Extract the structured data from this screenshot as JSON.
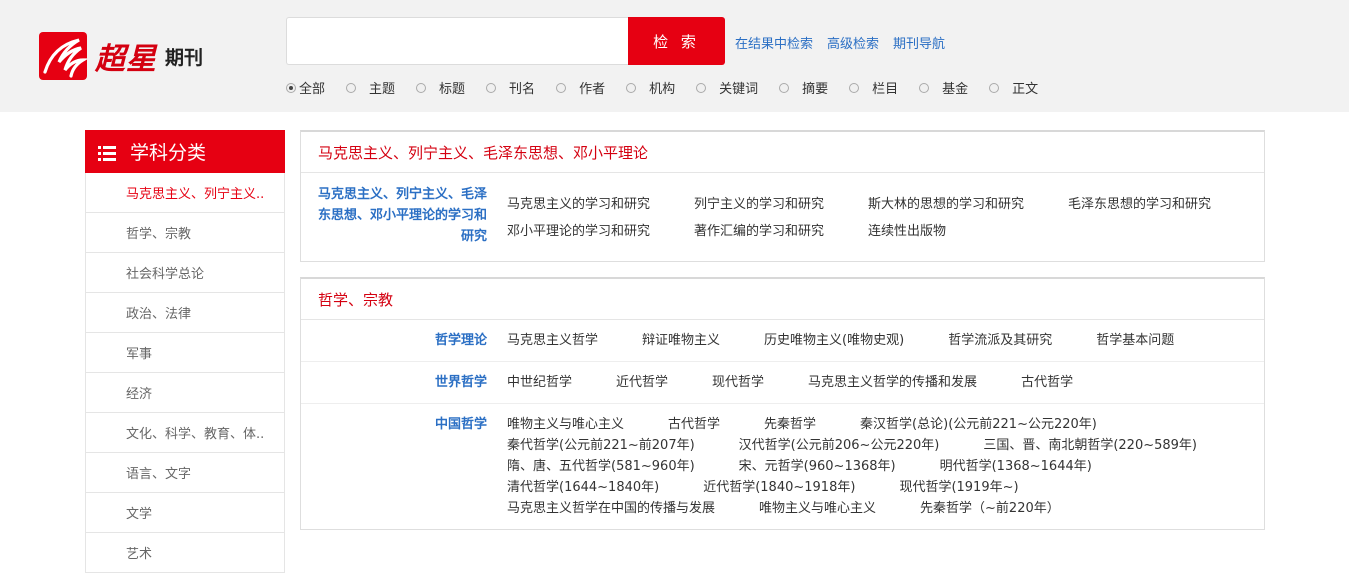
{
  "header": {
    "brand": "超星",
    "brand_sub": "期刊",
    "search_placeholder": "",
    "search_button": "检 索",
    "links": [
      "在结果中检索",
      "高级检索",
      "期刊导航"
    ],
    "scopes": [
      {
        "label": "全部",
        "checked": true
      },
      {
        "label": "主题",
        "checked": false
      },
      {
        "label": "标题",
        "checked": false
      },
      {
        "label": "刊名",
        "checked": false
      },
      {
        "label": "作者",
        "checked": false
      },
      {
        "label": "机构",
        "checked": false
      },
      {
        "label": "关键词",
        "checked": false
      },
      {
        "label": "摘要",
        "checked": false
      },
      {
        "label": "栏目",
        "checked": false
      },
      {
        "label": "基金",
        "checked": false
      },
      {
        "label": "正文",
        "checked": false
      }
    ]
  },
  "sidebar": {
    "title": "学科分类",
    "items": [
      "马克思主义、列宁主义..",
      "哲学、宗教",
      "社会科学总论",
      "政治、法律",
      "军事",
      "经济",
      "文化、科学、教育、体..",
      "语言、文字",
      "文学",
      "艺术"
    ]
  },
  "panels": [
    {
      "title": "马克思主义、列宁主义、毛泽东思想、邓小平理论",
      "rows": [
        {
          "label": "马克思主义、列宁主义、毛泽东思想、邓小平理论的学习和研究",
          "items": [
            "马克思主义的学习和研究",
            "列宁主义的学习和研究",
            "斯大林的思想的学习和研究",
            "毛泽东思想的学习和研究",
            "邓小平理论的学习和研究",
            "著作汇编的学习和研究",
            "连续性出版物"
          ]
        }
      ]
    },
    {
      "title": "哲学、宗教",
      "rows": [
        {
          "label": "哲学理论",
          "items": [
            "马克思主义哲学",
            "辩证唯物主义",
            "历史唯物主义(唯物史观)",
            "哲学流派及其研究",
            "哲学基本问题"
          ]
        },
        {
          "label": "世界哲学",
          "items": [
            "中世纪哲学",
            "近代哲学",
            "现代哲学",
            "马克思主义哲学的传播和发展",
            "古代哲学"
          ]
        },
        {
          "label": "中国哲学",
          "items": [
            "唯物主义与唯心主义",
            "古代哲学",
            "先秦哲学",
            "秦汉哲学(总论)(公元前221~公元220年)",
            "秦代哲学(公元前221~前207年)",
            "汉代哲学(公元前206~公元220年)",
            "三国、晋、南北朝哲学(220~589年)",
            "隋、唐、五代哲学(581~960年)",
            "宋、元哲学(960~1368年)",
            "明代哲学(1368~1644年)",
            "清代哲学(1644~1840年)",
            "近代哲学(1840~1918年)",
            "现代哲学(1919年~)",
            "马克思主义哲学在中国的传播与发展",
            "唯物主义与唯心主义",
            "先秦哲学（~前220年）"
          ]
        }
      ]
    }
  ]
}
